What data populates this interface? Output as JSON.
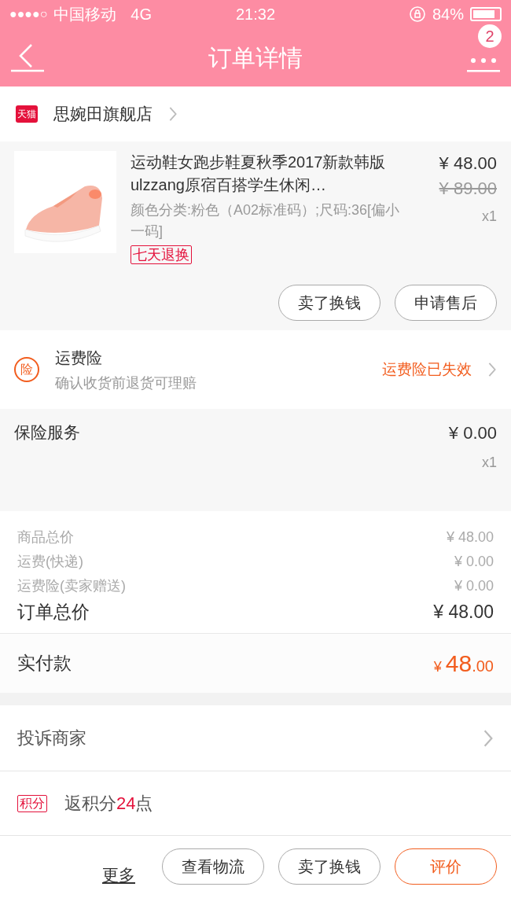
{
  "status_bar": {
    "signal": "●●●●○",
    "carrier": "中国移动",
    "network": "4G",
    "time": "21:32",
    "battery": "84%"
  },
  "nav": {
    "title": "订单详情",
    "badge": "2"
  },
  "store": {
    "badge": "天猫",
    "name": "思婉田旗舰店"
  },
  "product": {
    "title": "运动鞋女跑步鞋夏秋季2017新款韩版ulzzang原宿百搭学生休闲…",
    "sku": "颜色分类:粉色（A02标准码）;尺码:36[偏小一码]",
    "tag": "七天退换",
    "price": "¥ 48.00",
    "original_price": "¥ 89.00",
    "quantity": "x1",
    "buttons": [
      "卖了换钱",
      "申请售后"
    ]
  },
  "shipping_insurance": {
    "icon": "险",
    "title": "运费险",
    "subtitle": "确认收货前退货可理赔",
    "status": "运费险已失效"
  },
  "insurance_service": {
    "title": "保险服务",
    "price": "¥ 0.00",
    "quantity": "x1"
  },
  "summary": [
    {
      "label": "商品总价",
      "value": "¥ 48.00",
      "kind": "minor"
    },
    {
      "label": "运费(快递)",
      "value": "¥ 0.00",
      "kind": "minor"
    },
    {
      "label": "运费险(卖家赠送)",
      "value": "¥ 0.00",
      "kind": "minor"
    },
    {
      "label": "订单总价",
      "value": "¥ 48.00",
      "kind": "total"
    }
  ],
  "paid": {
    "label": "实付款",
    "currency": "¥",
    "integer": "48",
    "decimals": ".00"
  },
  "complaint": {
    "label": "投诉商家"
  },
  "points": {
    "badge": "积分",
    "prefix": "返积分",
    "value": "24",
    "suffix": "点"
  },
  "bottom_actions": [
    {
      "label": "更多",
      "kind": "link"
    },
    {
      "label": "查看物流",
      "kind": "button"
    },
    {
      "label": "卖了换钱",
      "kind": "button"
    },
    {
      "label": "评价",
      "kind": "primary"
    }
  ]
}
